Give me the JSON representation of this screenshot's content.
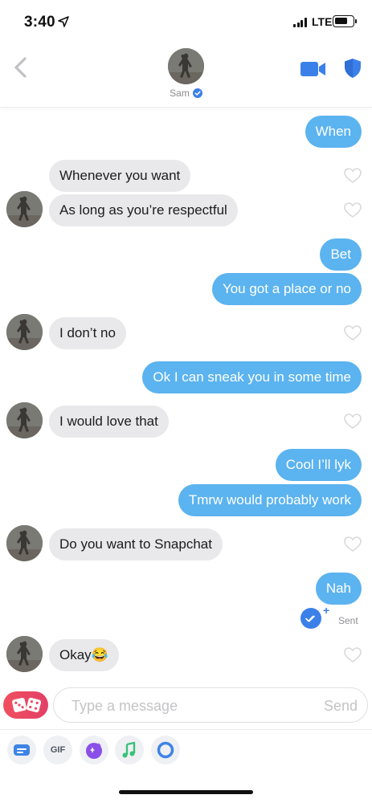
{
  "status_bar": {
    "time": "3:40",
    "network": "LTE"
  },
  "header": {
    "contact_name": "Sam"
  },
  "messages": [
    {
      "text": "When"
    },
    {
      "text": "Whenever you want"
    },
    {
      "text": "As long as you’re respectful"
    },
    {
      "text": "Bet"
    },
    {
      "text": "You got a place or no"
    },
    {
      "text": "I don’t no"
    },
    {
      "text": "Ok I can sneak you in some time"
    },
    {
      "text": "I would love that"
    },
    {
      "text": "Cool I’ll lyk"
    },
    {
      "text": "Tmrw would probably work"
    },
    {
      "text": "Do you want to Snapchat"
    },
    {
      "text": "Nah"
    },
    {
      "text": "Okay😂"
    }
  ],
  "receipt": {
    "status": "Sent"
  },
  "composer": {
    "placeholder": "Type a message",
    "send_label": "Send"
  },
  "toolbar": {
    "gif_label": "GIF"
  },
  "colors": {
    "outgoing_bubble": "#5bb3ef",
    "incoming_bubble": "#e9e9eb",
    "accent_blue": "#3b80e8",
    "games_red": "#f0505f"
  }
}
